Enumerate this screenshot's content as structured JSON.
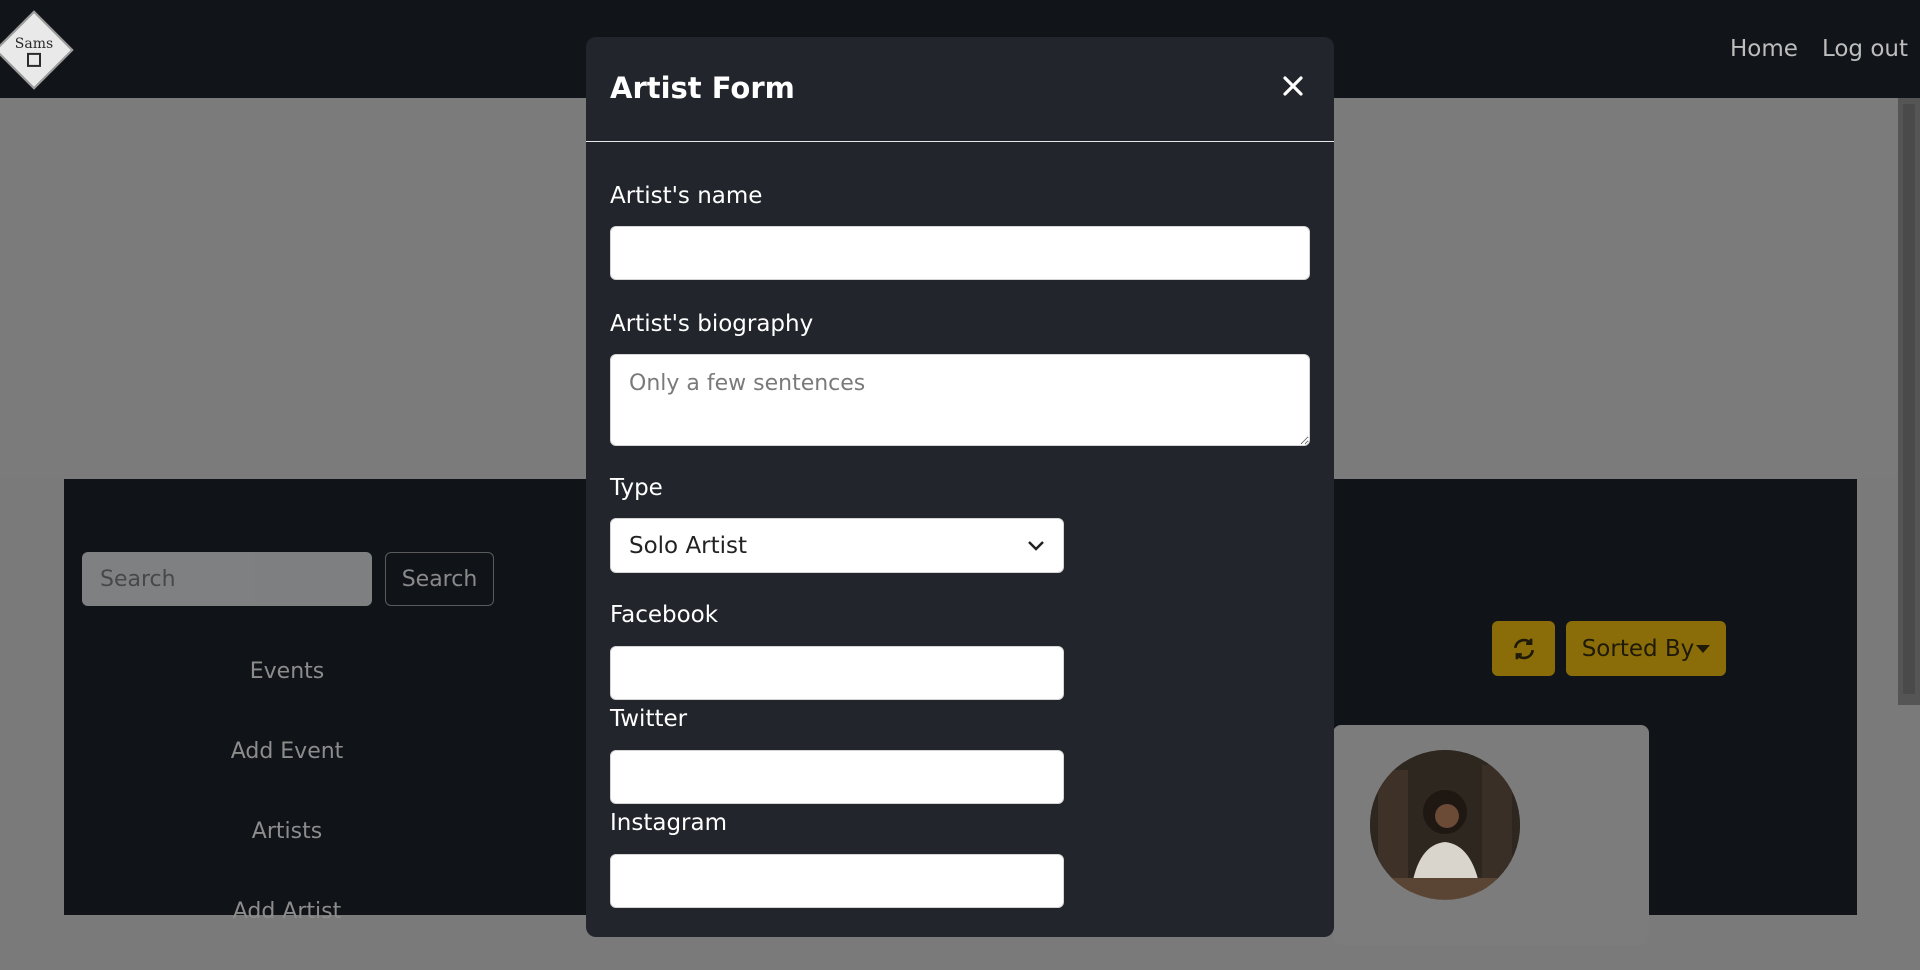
{
  "navbar": {
    "logo_text": "Sams",
    "links": [
      "Home",
      "Log out"
    ]
  },
  "background": {
    "search_placeholder": "Search",
    "search_button": "Search",
    "menu_items": [
      "Events",
      "Add Event",
      "Artists",
      "Add Artist"
    ],
    "sorted_button": "Sorted By"
  },
  "modal": {
    "title": "Artist Form",
    "close_label": "×",
    "fields": {
      "name_label": "Artist's name",
      "name_value": "",
      "bio_label": "Artist's biography",
      "bio_placeholder": "Only a few sentences",
      "type_label": "Type",
      "type_selected": "Solo Artist",
      "facebook_label": "Facebook",
      "facebook_value": "",
      "twitter_label": "Twitter",
      "twitter_value": "",
      "instagram_label": "Instagram",
      "instagram_value": ""
    }
  },
  "colors": {
    "navbar": "#111418",
    "modal_bg": "#22262c",
    "accent_yellow": "#8a6d09"
  },
  "icons": [
    "close-icon",
    "refresh-icon",
    "chevron-down-icon",
    "caret-down-icon"
  ]
}
